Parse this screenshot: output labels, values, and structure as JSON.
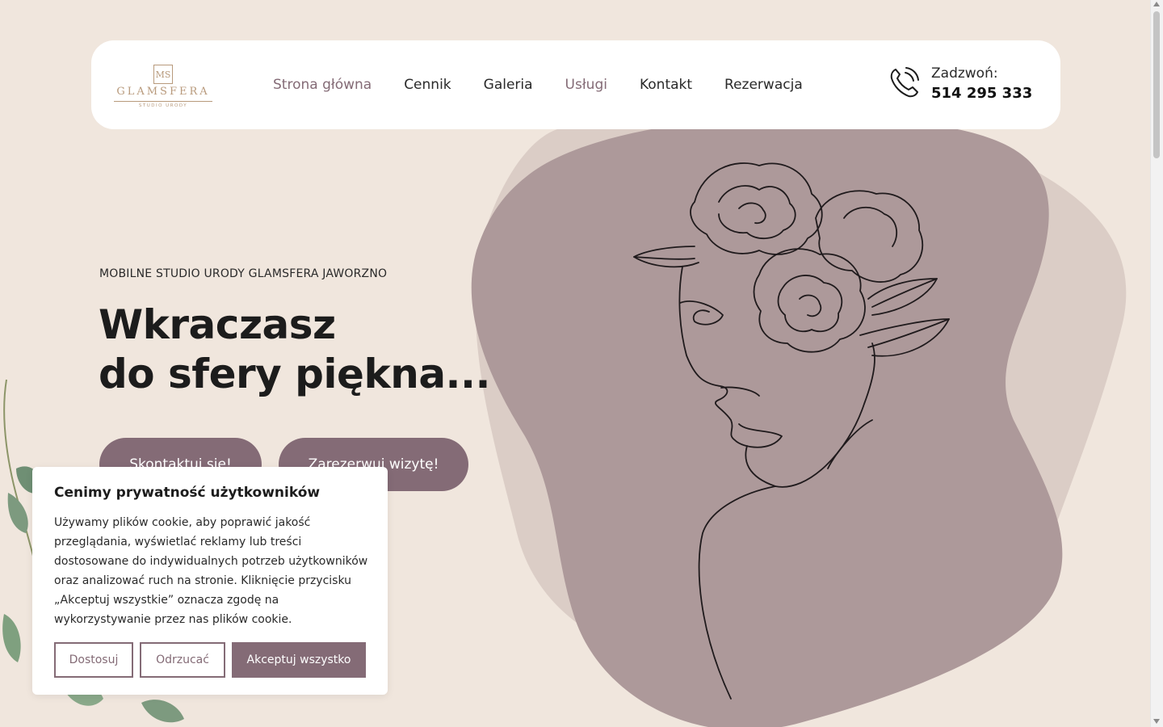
{
  "header": {
    "logo": {
      "monogram": "MS",
      "name": "GLAMSFERA",
      "tagline": "STUDIO URODY"
    },
    "nav": [
      {
        "label": "Strona główna"
      },
      {
        "label": "Cennik"
      },
      {
        "label": "Galeria"
      },
      {
        "label": "Usługi"
      },
      {
        "label": "Kontakt"
      },
      {
        "label": "Rezerwacja"
      }
    ],
    "phone": {
      "label": "Zadzwoń:",
      "number": "514 295 333",
      "icon": "phone-icon"
    }
  },
  "hero": {
    "eyebrow": "MOBILNE STUDIO URODY GLAMSFERA JAWORZNO",
    "headline_line1": "Wkraczasz",
    "headline_line2": "do sfery piękna...",
    "buttons": {
      "contact": "Skontaktuj się!",
      "book": "Zarezerwuj wizytę!"
    }
  },
  "cookie": {
    "title": "Cenimy prywatność użytkowników",
    "text": "Używamy plików cookie, aby poprawić jakość przeglądania, wyświetlać reklamy lub treści dostosowane do indywidualnych potrzeb użytkowników oraz analizować ruch na stronie. Kliknięcie przycisku „Akceptuj wszystkie” oznacza zgodę na wykorzystywanie przez nas plików cookie.",
    "buttons": {
      "customize": "Dostosuj",
      "reject": "Odrzucać",
      "accept": "Akceptuj wszystko"
    }
  },
  "colors": {
    "background": "#f0e6dd",
    "accent": "#846b76",
    "blob_front": "#ad999a",
    "blob_back": "#dbcdc6",
    "logo_gold": "#b89a7c"
  }
}
